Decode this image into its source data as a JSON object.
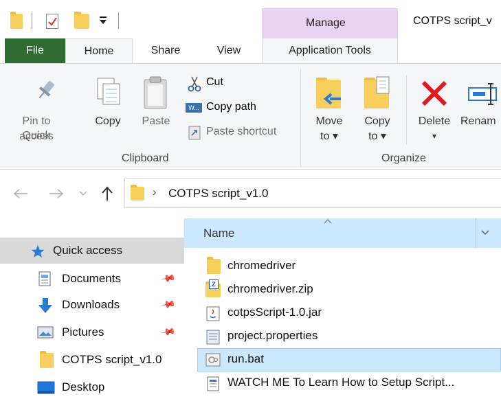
{
  "titlebar": {
    "manage_label": "Manage",
    "window_title": "COTPS script_v"
  },
  "tabs": {
    "file": "File",
    "home": "Home",
    "share": "Share",
    "view": "View",
    "application_tools": "Application Tools"
  },
  "ribbon": {
    "pin_line1": "Pin to Quick",
    "pin_line2": "access",
    "copy": "Copy",
    "paste": "Paste",
    "cut": "Cut",
    "copy_path": "Copy path",
    "paste_shortcut": "Paste shortcut",
    "clipboard_group": "Clipboard",
    "move_to_line1": "Move",
    "move_to_line2": "to ▾",
    "copy_to_line1": "Copy",
    "copy_to_line2": "to ▾",
    "delete": "Delete",
    "delete_arrow": "▾",
    "rename": "Renam",
    "organize_group": "Organize"
  },
  "address": {
    "separator": "›",
    "path": "COTPS script_v1.0"
  },
  "nav": {
    "quick_access": "Quick access",
    "items": [
      {
        "label": "Documents",
        "pinned": true
      },
      {
        "label": "Downloads",
        "pinned": true
      },
      {
        "label": "Pictures",
        "pinned": true
      },
      {
        "label": "COTPS script_v1.0",
        "pinned": false
      },
      {
        "label": "Desktop",
        "pinned": false
      }
    ]
  },
  "filelist": {
    "name_header": "Name",
    "files": [
      {
        "name": "chromedriver",
        "icon": "folder-icon"
      },
      {
        "name": "chromedriver.zip",
        "icon": "zip-icon"
      },
      {
        "name": "cotpsScript-1.0.jar",
        "icon": "jar-icon"
      },
      {
        "name": "project.properties",
        "icon": "properties-icon"
      },
      {
        "name": "run.bat",
        "icon": "bat-icon",
        "selected": true
      },
      {
        "name": "WATCH ME To Learn How to Setup Script...",
        "icon": "text-file-icon"
      }
    ]
  },
  "colors": {
    "file_tab": "#2f6b31",
    "manage_band": "#e8d3f3",
    "selection": "#cce8ff",
    "folder": "#f8cf5c"
  }
}
